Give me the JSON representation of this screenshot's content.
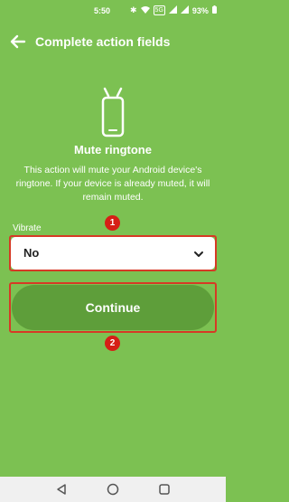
{
  "status_bar": {
    "time": "5:50",
    "network_badge": "5G",
    "battery": "93%",
    "icons": [
      "bluetooth-icon",
      "wifi-icon",
      "signal-icon",
      "battery-icon"
    ]
  },
  "header": {
    "title": "Complete action fields",
    "back_icon": "arrow-left-icon"
  },
  "action": {
    "icon": "android-phone-icon",
    "title": "Mute ringtone",
    "description": "This action will mute your Android device's ringtone. If your device is already muted, it will remain muted."
  },
  "vibrate_field": {
    "label": "Vibrate",
    "selected": "No"
  },
  "continue_button": {
    "label": "Continue"
  },
  "annotations": {
    "marker_1": "1",
    "marker_2": "2",
    "color": "#d61f16"
  },
  "colors": {
    "background": "#7cc152",
    "button": "#5e9e3a",
    "highlight": "#d63a25"
  },
  "nav_bar": {
    "icons": [
      "back-triangle-icon",
      "home-circle-icon",
      "recents-square-icon"
    ]
  }
}
